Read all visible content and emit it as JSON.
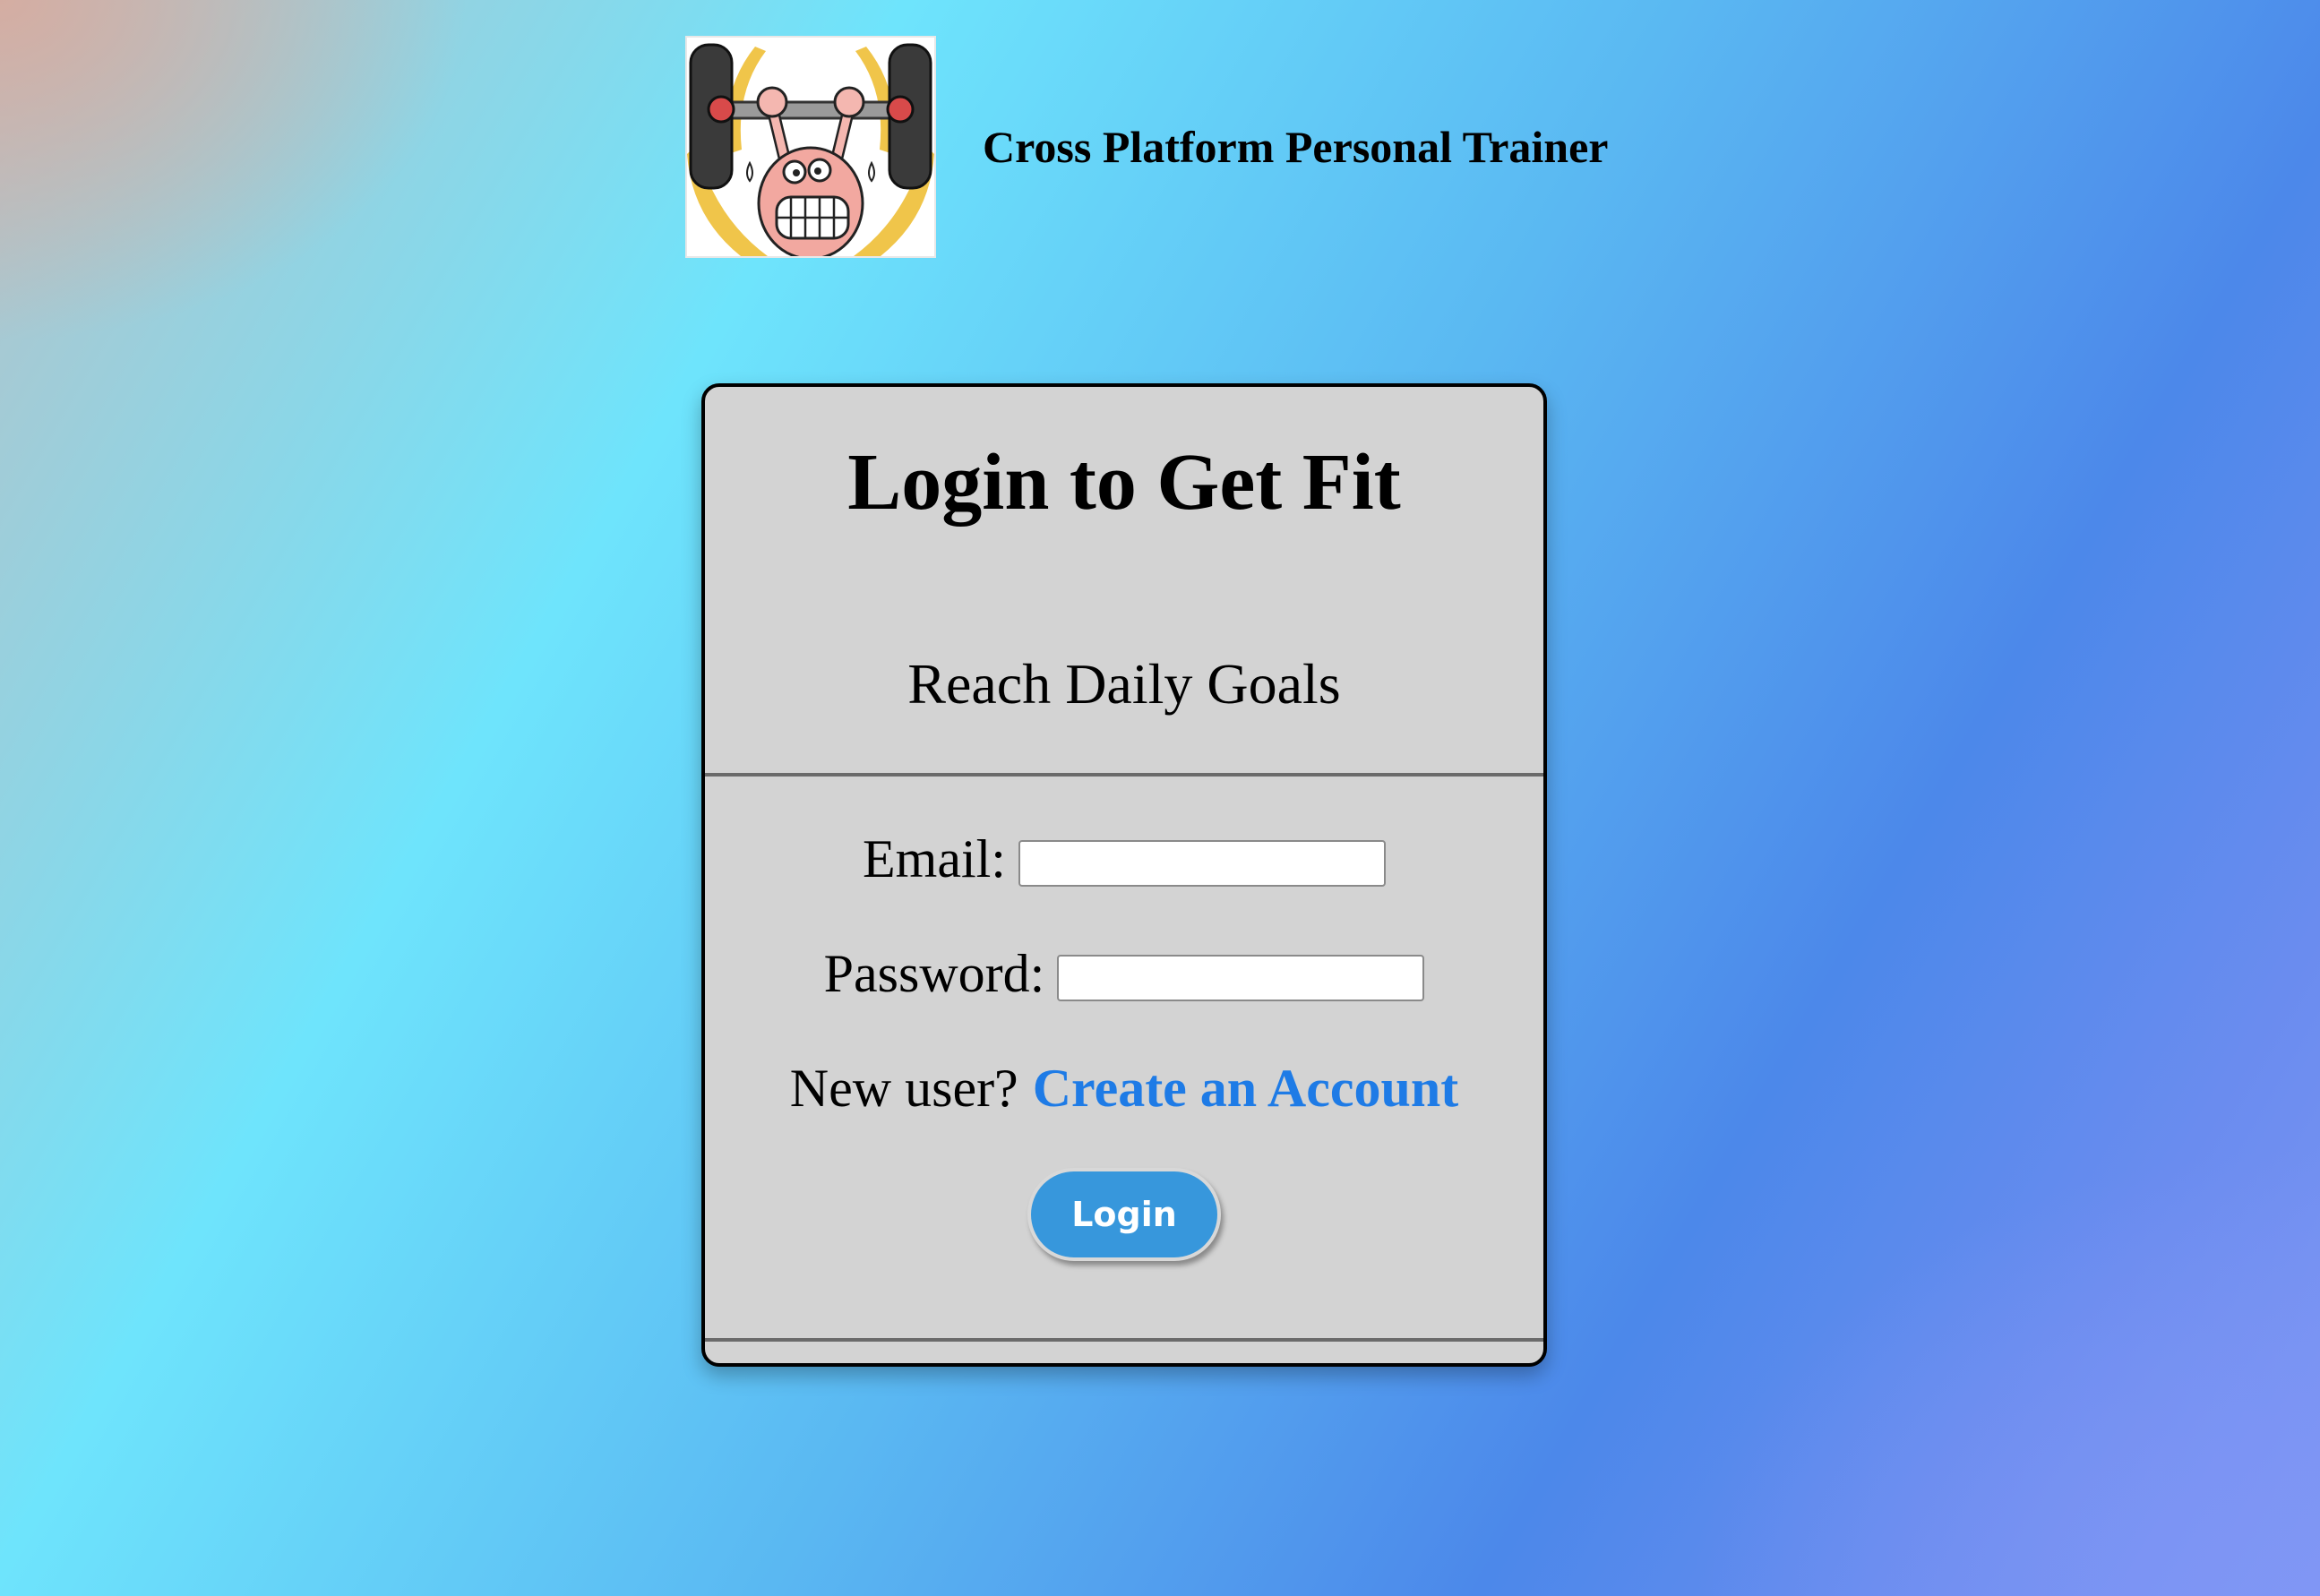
{
  "header": {
    "logo_alt": "weightlifter cartoon logo",
    "site_title": "Cross Platform Personal Trainer"
  },
  "card": {
    "title": "Login to Get Fit",
    "subtitle": "Reach Daily Goals",
    "email": {
      "label": "Email:",
      "value": "",
      "placeholder": ""
    },
    "password": {
      "label": "Password:",
      "value": "",
      "placeholder": ""
    },
    "new_user": {
      "prompt": "New user?",
      "link_label": "Create an Account"
    },
    "login_button_label": "Login"
  },
  "colors": {
    "card_background": "#d3d3d3",
    "link": "#1e7be6",
    "button": "#3797dc",
    "divider": "#6a6a6a"
  },
  "icons": {
    "logo": "weightlifter-icon"
  }
}
